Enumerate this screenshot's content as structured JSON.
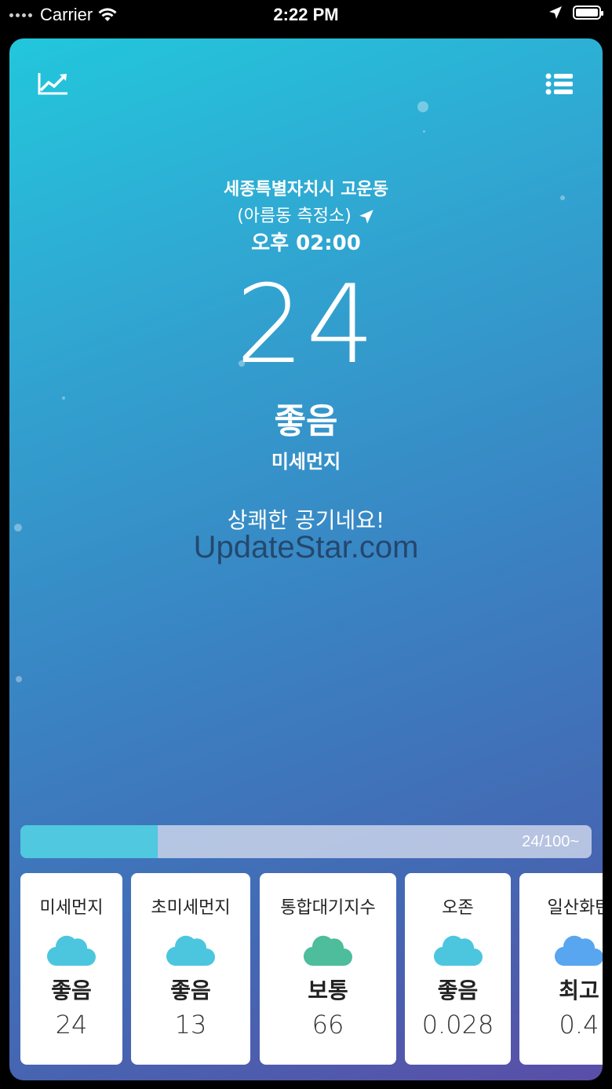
{
  "status_bar": {
    "carrier": "Carrier",
    "time": "2:22 PM"
  },
  "header": {
    "chart_icon": "trend-chart-icon",
    "menu_icon": "list-menu-icon"
  },
  "location": {
    "name": "세종특별자치시 고운동",
    "station": "(아름동 측정소)",
    "time": "오후 02:00"
  },
  "current": {
    "value": "24",
    "grade": "좋음",
    "pollutant": "미세먼지",
    "message": "상쾌한 공기네요!"
  },
  "watermark": "UpdateStar.com",
  "progress": {
    "label": "24/100~",
    "fraction": 0.24
  },
  "tiles": [
    {
      "name": "미세먼지",
      "grade": "좋음",
      "value": "24",
      "icon_color": "#4cc6df"
    },
    {
      "name": "초미세먼지",
      "grade": "좋음",
      "value": "13",
      "icon_color": "#4cc6df"
    },
    {
      "name": "통합대기지수",
      "grade": "보통",
      "value": "66",
      "icon_color": "#4dbd9c"
    },
    {
      "name": "오존",
      "grade": "좋음",
      "value": "0.028",
      "icon_color": "#4cc6df"
    },
    {
      "name": "일산화탄",
      "grade": "최고",
      "value": "0.4",
      "icon_color": "#58a6f0"
    }
  ],
  "colors": {
    "gradient_start": "#22c7dc",
    "gradient_end": "#5a4ea7",
    "progress_fill": "#4fc8e0"
  }
}
